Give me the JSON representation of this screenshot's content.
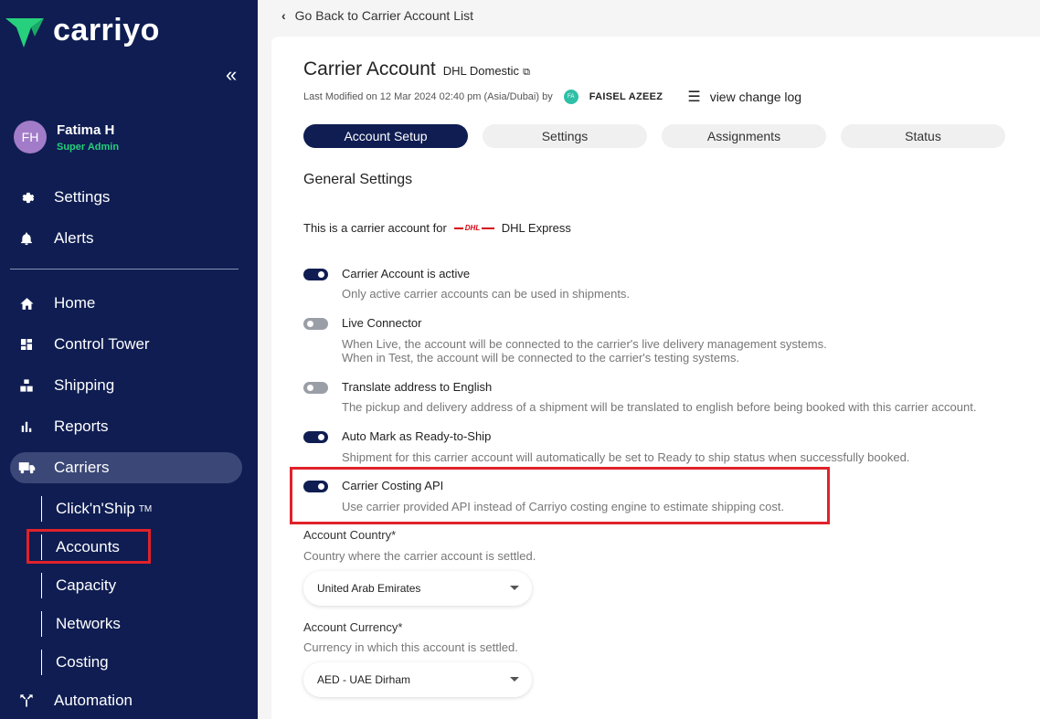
{
  "app": {
    "name": "carriyo"
  },
  "user": {
    "initials": "FH",
    "name": "Fatima H",
    "role": "Super Admin"
  },
  "sidebar": {
    "top_items": [
      {
        "label": "Settings",
        "icon": "gear-icon"
      },
      {
        "label": "Alerts",
        "icon": "bell-icon"
      }
    ],
    "items": [
      {
        "label": "Home",
        "icon": "home-icon"
      },
      {
        "label": "Control Tower",
        "icon": "dashboard-icon"
      },
      {
        "label": "Shipping",
        "icon": "shipping-icon"
      },
      {
        "label": "Reports",
        "icon": "bar-chart-icon"
      },
      {
        "label": "Carriers",
        "icon": "truck-icon"
      },
      {
        "label": "Automation",
        "icon": "automation-icon"
      }
    ],
    "carrier_sub": [
      {
        "label": "Click'n'Ship",
        "sup": "TM"
      },
      {
        "label": "Accounts"
      },
      {
        "label": "Capacity"
      },
      {
        "label": "Networks"
      },
      {
        "label": "Costing"
      }
    ]
  },
  "back_link": "Go Back to Carrier Account List",
  "header": {
    "title": "Carrier Account",
    "subtitle": "DHL Domestic",
    "last_modified": "Last Modified on 12 Mar 2024 02:40 pm (Asia/Dubai) by",
    "modifier_initials": "FA",
    "modifier_name": "FAISEL AZEEZ",
    "change_log": "view change log"
  },
  "tabs": [
    "Account Setup",
    "Settings",
    "Assignments",
    "Status"
  ],
  "general": {
    "title": "General Settings",
    "carrier_intro": "This is a carrier account for",
    "carrier_logo_text": "DHL",
    "carrier_name": "DHL Express"
  },
  "options": [
    {
      "label": "Carrier Account is active",
      "desc1": "Only active carrier accounts can be used in shipments.",
      "on": true
    },
    {
      "label": "Live Connector",
      "desc1": "When Live, the account will be connected to the carrier's live delivery management systems.",
      "desc2": "When in Test, the account will be connected to the carrier's testing systems.",
      "on": false
    },
    {
      "label": "Translate address to English",
      "desc1": "The pickup and delivery address of a shipment will be translated to english before being booked with this carrier account.",
      "on": false
    },
    {
      "label": "Auto Mark as Ready-to-Ship",
      "desc1": "Shipment for this carrier account will automatically be set to Ready to ship status when successfully booked.",
      "on": true
    },
    {
      "label": "Carrier Costing API",
      "desc1": "Use carrier provided API instead of Carriyo costing engine to estimate shipping cost.",
      "on": true
    }
  ],
  "fields": {
    "country": {
      "label": "Account Country*",
      "desc": "Country where the carrier account is settled.",
      "value": "United Arab Emirates"
    },
    "currency": {
      "label": "Account Currency*",
      "desc": "Currency in which this account is settled.",
      "value": "AED - UAE Dirham"
    }
  },
  "colors": {
    "sidebar": "#0f1d52",
    "accent": "#0f1d52",
    "highlight": "#e0222a",
    "role": "#26d07c"
  }
}
